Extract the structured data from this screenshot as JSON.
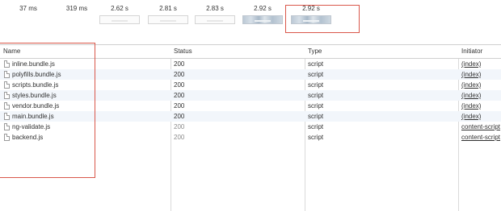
{
  "filmstrip": {
    "frames": [
      {
        "time": "37 ms",
        "loaded": false,
        "blank": true
      },
      {
        "time": "319 ms",
        "loaded": false,
        "blank": true
      },
      {
        "time": "2.62 s",
        "loaded": false,
        "blank": false
      },
      {
        "time": "2.81 s",
        "loaded": false,
        "blank": false
      },
      {
        "time": "2.83 s",
        "loaded": false,
        "blank": false
      },
      {
        "time": "2.92 s",
        "loaded": true,
        "blank": false
      },
      {
        "time": "2.92 s",
        "loaded": true,
        "blank": false
      }
    ]
  },
  "table": {
    "headers": {
      "name": "Name",
      "status": "Status",
      "type": "Type",
      "initiator": "Initiator"
    },
    "rows": [
      {
        "name": "inline.bundle.js",
        "status": "200",
        "type": "script",
        "initiator": "(index)",
        "muted": false
      },
      {
        "name": "polyfills.bundle.js",
        "status": "200",
        "type": "script",
        "initiator": "(index)",
        "muted": false
      },
      {
        "name": "scripts.bundle.js",
        "status": "200",
        "type": "script",
        "initiator": "(index)",
        "muted": false
      },
      {
        "name": "styles.bundle.js",
        "status": "200",
        "type": "script",
        "initiator": "(index)",
        "muted": false
      },
      {
        "name": "vendor.bundle.js",
        "status": "200",
        "type": "script",
        "initiator": "(index)",
        "muted": false
      },
      {
        "name": "main.bundle.js",
        "status": "200",
        "type": "script",
        "initiator": "(index)",
        "muted": false
      },
      {
        "name": "ng-validate.js",
        "status": "200",
        "type": "script",
        "initiator": "content-script",
        "muted": true
      },
      {
        "name": "backend.js",
        "status": "200",
        "type": "script",
        "initiator": "content-script",
        "muted": true
      }
    ]
  },
  "colors": {
    "highlight": "#d9574a",
    "row_alt": "#f2f6fb"
  }
}
